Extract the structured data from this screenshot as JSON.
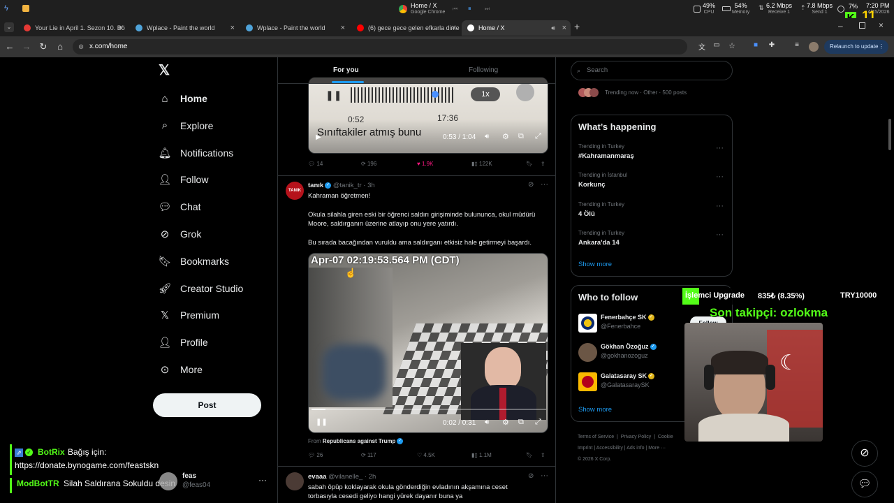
{
  "os_bar": {
    "window_title": "Home / X",
    "window_subtitle": "Google Chrome",
    "cpu": {
      "value": "49%",
      "label": "CPU"
    },
    "memory": {
      "value": "54%",
      "label": "Memory"
    },
    "receive": {
      "value": "6.2 Mbps",
      "label": "Receive 1"
    },
    "send": {
      "value": "7.8 Mbps",
      "label": "Send 1"
    },
    "battery": "7%",
    "time": "7:20 PM",
    "date": "4/15/2026",
    "stream_badge": "11"
  },
  "browser": {
    "tabs": [
      {
        "label": "Your Lie in April 1. Sezon 10. Bö",
        "icon_color": "#e53935",
        "active": false
      },
      {
        "label": "Wplace - Paint the world",
        "icon_color": "#4fa3d9",
        "active": false
      },
      {
        "label": "Wplace - Paint the world",
        "icon_color": "#4fa3d9",
        "active": false
      },
      {
        "label": "(6) gece gece gelen efkarla dinle",
        "icon_color": "#ff0000",
        "active": false
      },
      {
        "label": "Home / X",
        "icon_color": "#ffffff",
        "active": true
      }
    ],
    "url": "x.com/home",
    "relaunch": "Relaunch to update"
  },
  "sidebar": {
    "items": [
      {
        "label": "Home",
        "icon": "home-icon"
      },
      {
        "label": "Explore",
        "icon": "search-icon"
      },
      {
        "label": "Notifications",
        "icon": "bell-icon"
      },
      {
        "label": "Follow",
        "icon": "follow-icon"
      },
      {
        "label": "Chat",
        "icon": "chat-icon"
      },
      {
        "label": "Grok",
        "icon": "grok-icon"
      },
      {
        "label": "Bookmarks",
        "icon": "bookmark-icon"
      },
      {
        "label": "Creator Studio",
        "icon": "rocket-icon"
      },
      {
        "label": "Premium",
        "icon": "x-logo-icon"
      },
      {
        "label": "Profile",
        "icon": "person-icon"
      },
      {
        "label": "More",
        "icon": "more-circle-icon"
      }
    ],
    "post": "Post"
  },
  "timeline": {
    "tabs": [
      "For you",
      "Following"
    ],
    "tweet1": {
      "audio_speed": "1x",
      "audio_elapsed": "0:52",
      "audio_total": "17:36",
      "caption": "Sınıftakiler atmış bunu",
      "video_time": "0:53 / 1:04",
      "replies": "14",
      "reposts": "196",
      "likes": "1.9K",
      "views": "122K"
    },
    "tweet2": {
      "avatar_text": "TANIK",
      "name": "tanık",
      "handle": "@tanik_tr",
      "time": "· 3h",
      "line1": "Kahraman öğretmen!",
      "line2": "Okula silahla giren eski bir öğrenci saldırı girişiminde bulununca, okul müdürü Moore, saldırganın üzerine atlayıp onu yere yatırdı.",
      "line3": "Bu sırada bacağından vuruldu ama saldırganı etkisiz hale getirmeyi başardı.",
      "timestamp_overlay": "Apr-07 02:19:53.564 PM (CDT)",
      "video_time": "0:02 / 0:31",
      "from_prefix": "From",
      "from_account": "Republicans against Trump",
      "replies": "26",
      "reposts": "117",
      "likes": "4.5K",
      "views": "1.1M"
    },
    "tweet3": {
      "name": "evaaa",
      "handle": "@vilanelle_",
      "time": "· 2h",
      "text": "sabah öpüp koklayarak okula gönderdiğin evladının akşamına ceset torbasıyla cesedi geliyo hangi yürek dayanır buna ya"
    }
  },
  "right": {
    "search_placeholder": "Search",
    "trending_now": "Trending now · Other · 500 posts",
    "happening_title": "What’s happening",
    "trends": [
      {
        "context": "Trending in Turkey",
        "title": "#Kahramanmaraş"
      },
      {
        "context": "Trending in İstanbul",
        "title": "Korkunç"
      },
      {
        "context": "Trending in Turkey",
        "title": "4 Ölü"
      },
      {
        "context": "Trending in Turkey",
        "title": "Ankara'da 14"
      }
    ],
    "show_more": "Show more",
    "who_title": "Who to follow",
    "follows": [
      {
        "name": "Fenerbahçe SK",
        "handle": "@Fenerbahce",
        "badge": "gold"
      },
      {
        "name": "Gökhan Özoğuz",
        "handle": "@gokhanozoguz",
        "badge": "blue"
      },
      {
        "name": "Galatasaray SK",
        "handle": "@GalatasaraySK",
        "badge": "gold"
      }
    ],
    "follow_button": "Follow",
    "footer": [
      "Terms of Service",
      "Privacy Policy",
      "Cookie",
      "Imprint",
      "Accessibility",
      "Ads info",
      "More ···",
      "© 2026 X Corp."
    ]
  },
  "stream": {
    "goal_label": "İşlemci Upgrade",
    "goal_value": "835₺ (8.35%)",
    "goal_progress": 0.0835,
    "goal_target": "TRY10000",
    "last_follower": "Son takipçi: ozlokma",
    "chat": [
      {
        "user": "BotRix",
        "text": "Bağış için:",
        "color": "#53fc18"
      },
      {
        "user": "",
        "text": "https://donate.bynogame.com/feastskn",
        "color": "#ffffff"
      },
      {
        "user": "ModBotTR",
        "text": "Silah Saldırana Sokuldu desin",
        "color": "#53fc18"
      }
    ],
    "account_name": "feas",
    "account_handle": "@feas04"
  }
}
